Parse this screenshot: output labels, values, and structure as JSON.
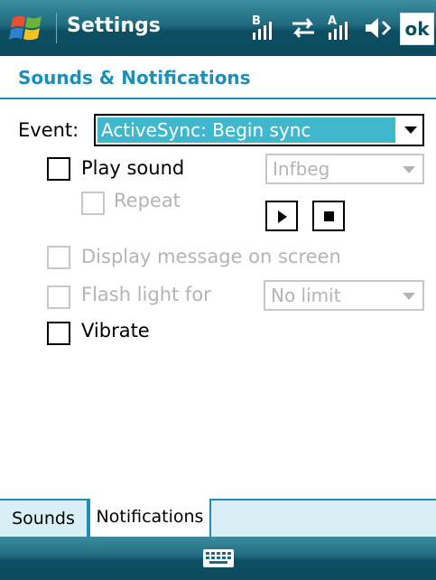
{
  "titlebar": {
    "title": "Settings",
    "ok_label": "ok",
    "icons": [
      "windows-start-icon",
      "signal-b-icon",
      "sync-arrows-icon",
      "signal-a-icon",
      "speaker-icon"
    ]
  },
  "header": {
    "title": "Sounds & Notifications"
  },
  "event": {
    "label": "Event:",
    "value": "ActiveSync: Begin sync"
  },
  "options": {
    "play_sound": {
      "label": "Play sound",
      "sound_value": "Infbeg"
    },
    "repeat": {
      "label": "Repeat"
    },
    "display_message": {
      "label": "Display message on screen"
    },
    "flash_light": {
      "label": "Flash light for",
      "duration_value": "No limit"
    },
    "vibrate": {
      "label": "Vibrate"
    }
  },
  "tabs": [
    {
      "label": "Sounds"
    },
    {
      "label": "Notifications"
    }
  ],
  "bottombar": {
    "icon": "keyboard-icon"
  },
  "colors": {
    "accent": "#1e8fb4",
    "selection": "#3fb7cc",
    "bar": "#1f6a7e"
  }
}
